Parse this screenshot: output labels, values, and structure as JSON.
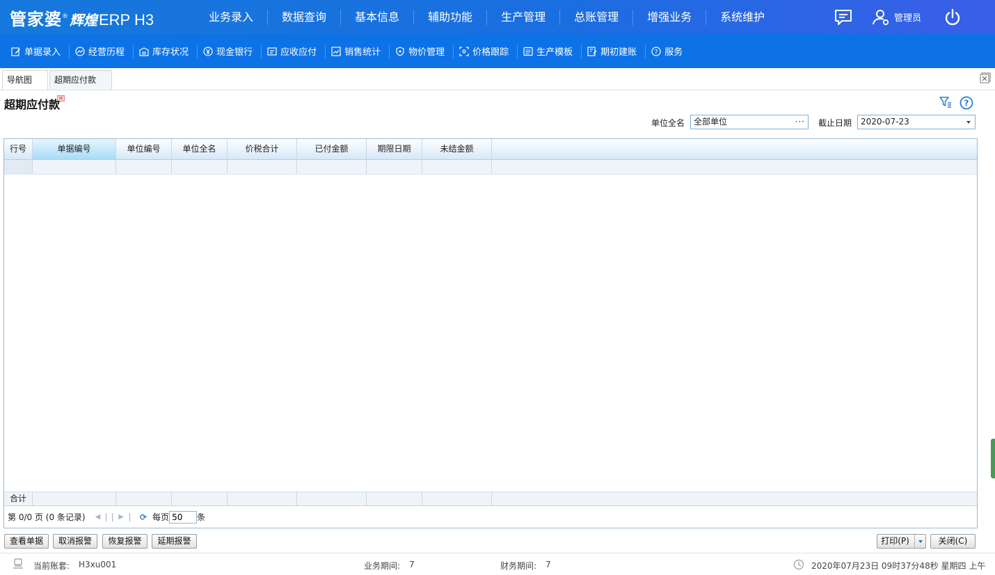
{
  "header": {
    "brand": "管家婆",
    "reg": "®",
    "product": "辉煌",
    "edition": "ERP H3",
    "nav": [
      "业务录入",
      "数据查询",
      "基本信息",
      "辅助功能",
      "生产管理",
      "总账管理",
      "增强业务",
      "系统维护"
    ],
    "user": "管理员"
  },
  "toolbar": [
    {
      "label": "单据录入",
      "icon": "edit-icon"
    },
    {
      "label": "经营历程",
      "icon": "trend-icon"
    },
    {
      "label": "库存状况",
      "icon": "warehouse-icon"
    },
    {
      "label": "现金银行",
      "icon": "yuan-icon"
    },
    {
      "label": "应收应付",
      "icon": "ledger-icon"
    },
    {
      "label": "销售统计",
      "icon": "chart-icon"
    },
    {
      "label": "物价管理",
      "icon": "shield-icon"
    },
    {
      "label": "价格跟踪",
      "icon": "track-icon"
    },
    {
      "label": "生产模板",
      "icon": "template-icon"
    },
    {
      "label": "期初建账",
      "icon": "account-icon"
    },
    {
      "label": "服务",
      "icon": "help-icon"
    }
  ],
  "tabs": {
    "nav": "导航图",
    "active": "超期应付款"
  },
  "page": {
    "title": "超期应付款"
  },
  "criteria": {
    "unit_label": "单位全名",
    "unit_value": "全部单位",
    "unit_browse": "···",
    "date_label": "截止日期",
    "date_value": "2020-07-23"
  },
  "grid": {
    "columns": [
      "行号",
      "单据编号",
      "单位编号",
      "单位全名",
      "价税合计",
      "已付金额",
      "期限日期",
      "未结金额"
    ],
    "rows": [],
    "summary_label": "合计"
  },
  "pager": {
    "page_info": "第 0/0 页 (0 条记录)",
    "per_page_label": "每页",
    "per_page_value": "50",
    "unit": "条"
  },
  "buttons": {
    "view": "查看单据",
    "cancel_alarm": "取消报警",
    "restore_alarm": "恢复报警",
    "extend_alarm": "延期报警",
    "print": "打印(P)",
    "close": "关闭(C)"
  },
  "status": {
    "account_label": "当前账套:",
    "account_value": "H3xu001",
    "biz_period_label": "业务期间:",
    "biz_period_value": "7",
    "fin_period_label": "财务期间:",
    "fin_period_value": "7",
    "datetime": "2020年07月23日 09时37分48秒 星期四 上午"
  },
  "colors": {
    "header_blue": "#1678dc",
    "toolbar_blue": "#0d72e6",
    "grid_header": "#d6e8f7"
  }
}
